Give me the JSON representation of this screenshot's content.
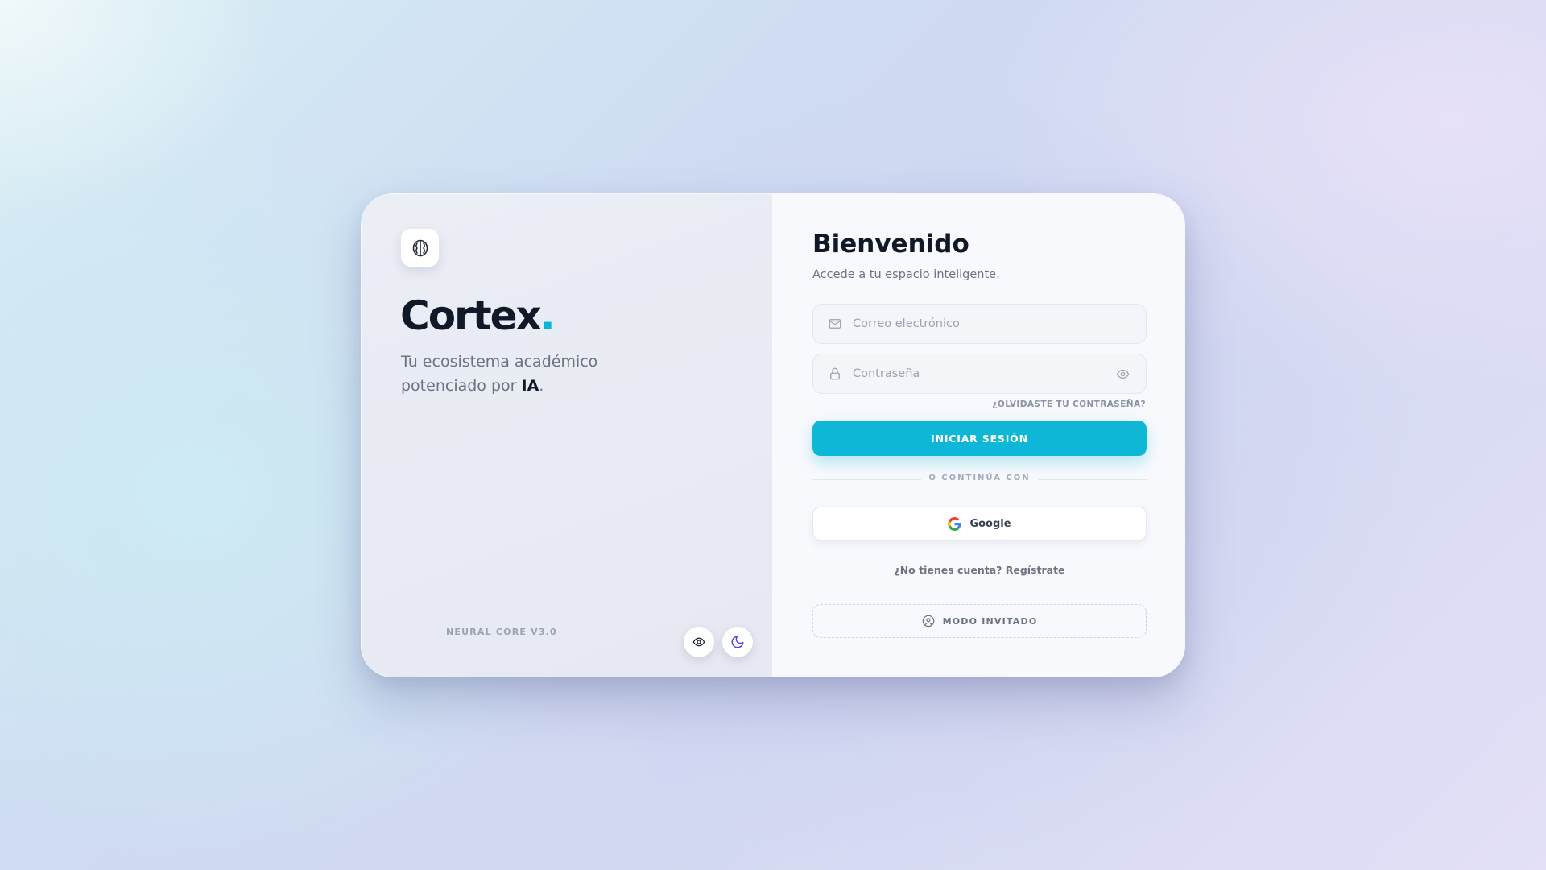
{
  "brand": {
    "name": "Cortex",
    "dot": ".",
    "tagline_pre": "Tu ecosistema académico potenciado por ",
    "tagline_bold": "IA",
    "tagline_post": ".",
    "logo_icon": "brain-icon",
    "version": "NEURAL CORE V3.0"
  },
  "theme_controls": {
    "accessibility_icon": "eye-icon",
    "dark_mode_icon": "moon-icon"
  },
  "login": {
    "title": "Bienvenido",
    "subtitle": "Accede a tu espacio inteligente.",
    "email_placeholder": "Correo electrónico",
    "password_placeholder": "Contraseña",
    "forgot": "¿OLVIDASTE TU CONTRASEÑA?",
    "submit": "INICIAR SESIÓN",
    "divider": "O CONTINÚA CON",
    "google": "Google",
    "register": "¿No tienes cuenta? Regístrate",
    "guest": "MODO INVITADO"
  },
  "colors": {
    "accent": "#0db7d5",
    "text_dark": "#111827",
    "text_muted": "#6b7280",
    "moon": "#4f46e5"
  }
}
